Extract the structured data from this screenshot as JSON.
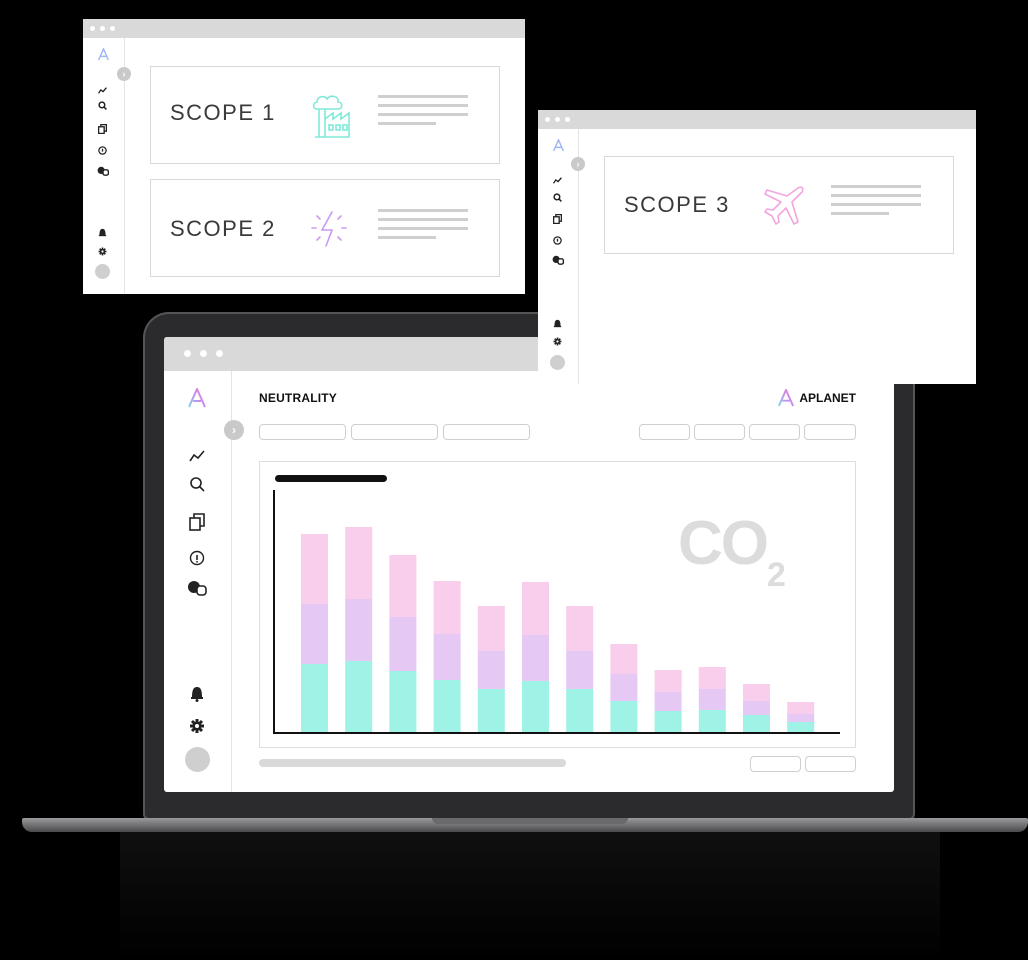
{
  "main": {
    "page_title": "NEUTRALITY",
    "brand_name": "APLANET",
    "co2_label": "CO",
    "co2_subscript": "2",
    "chart_data": {
      "type": "bar",
      "stacked": true,
      "series": [
        {
          "color": "#9ff2e6",
          "values": [
            68,
            71,
            61,
            52,
            43,
            51,
            43,
            31,
            21,
            22,
            17,
            10
          ]
        },
        {
          "color": "#e6c8f5",
          "values": [
            60,
            62,
            54,
            46,
            38,
            46,
            38,
            27,
            19,
            21,
            14,
            8
          ]
        },
        {
          "color": "#f9cdec",
          "values": [
            70,
            72,
            62,
            53,
            45,
            53,
            45,
            30,
            22,
            22,
            17,
            12
          ]
        }
      ],
      "colors": {
        "teal": "#9ff2e6",
        "lavender": "#e6c8f5",
        "pink": "#f9cdec"
      }
    }
  },
  "scope1": {
    "label": "SCOPE 1",
    "icon": "factory-icon"
  },
  "scope2": {
    "label": "SCOPE 2",
    "icon": "lightning-icon"
  },
  "scope3": {
    "label": "SCOPE 3",
    "icon": "airplane-icon"
  },
  "colors": {
    "teal": "#7fe9d8",
    "purple": "#c99bf0",
    "pink": "#f2a6dd",
    "logo_gradient": [
      "#7fd8f0",
      "#c48cf0",
      "#f27fc0"
    ]
  }
}
